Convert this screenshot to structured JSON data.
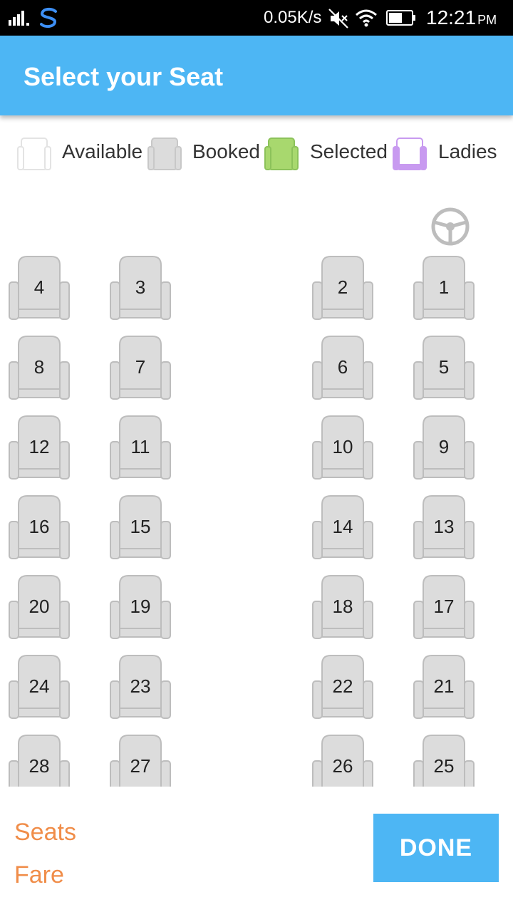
{
  "status_bar": {
    "speed": "0.05K/s",
    "time": "12:21",
    "ampm": "PM",
    "icons": [
      "signal-icon",
      "app-s-icon",
      "mute-icon",
      "wifi-icon",
      "battery-icon"
    ]
  },
  "app_bar": {
    "title": "Select your Seat"
  },
  "legend": [
    {
      "label": "Available",
      "state": "available"
    },
    {
      "label": "Booked",
      "state": "booked"
    },
    {
      "label": "Selected",
      "state": "selected"
    },
    {
      "label": "Ladies",
      "state": "ladies"
    }
  ],
  "colors": {
    "accent": "#4db6f4",
    "booked": "#dcdcdc",
    "selected": "#a8d86e",
    "ladies": "#c89af0",
    "label_orange": "#f08d49"
  },
  "seats": [
    {
      "rows": [
        "4",
        "3",
        "2",
        "1"
      ]
    },
    {
      "rows": [
        "8",
        "7",
        "6",
        "5"
      ]
    },
    {
      "rows": [
        "12",
        "11",
        "10",
        "9"
      ]
    },
    {
      "rows": [
        "16",
        "15",
        "14",
        "13"
      ]
    },
    {
      "rows": [
        "20",
        "19",
        "18",
        "17"
      ]
    },
    {
      "rows": [
        "24",
        "23",
        "22",
        "21"
      ]
    },
    {
      "rows": [
        "28",
        "27",
        "26",
        "25"
      ]
    }
  ],
  "bottom": {
    "seats_label": "Seats",
    "fare_label": "Fare",
    "done_label": "DONE"
  }
}
